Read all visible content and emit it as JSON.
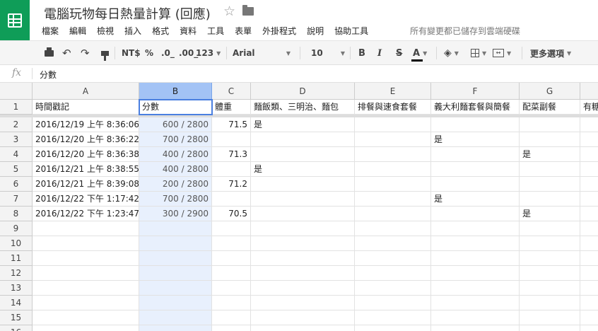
{
  "doc": {
    "title": "電腦玩物每日熱量計算 (回應)",
    "save_status": "所有變更都已儲存到雲端硬碟"
  },
  "menu": [
    "檔案",
    "編輯",
    "檢視",
    "插入",
    "格式",
    "資料",
    "工具",
    "表單",
    "外掛程式",
    "說明",
    "協助工具"
  ],
  "toolbar": {
    "currency": "NT$",
    "percent": "%",
    "dec_decrease": ".0_",
    "dec_increase": ".00_",
    "number_format": "123",
    "font": "Arial",
    "font_size": "10",
    "bold": "B",
    "italic": "I",
    "strike": "S",
    "text_color": "A",
    "more": "更多選項"
  },
  "formula": {
    "fx": "fx",
    "content": "分數"
  },
  "columns": [
    "A",
    "B",
    "C",
    "D",
    "E",
    "F",
    "G"
  ],
  "selected_column": "B",
  "header_row": [
    "時間戳記",
    "分數",
    "體重",
    "麵飯類、三明治、麵包",
    "排餐與速食套餐",
    "義大利麵套餐與簡餐",
    "配菜副餐",
    "有糖"
  ],
  "rows": [
    [
      "2016/12/19 上午 8:36:06",
      "600 / 2800",
      "71.5",
      "是",
      "",
      "",
      ""
    ],
    [
      "2016/12/20 上午 8:36:22",
      "700 / 2800",
      "",
      "",
      "",
      "是",
      ""
    ],
    [
      "2016/12/20 上午 8:36:38",
      "400 / 2800",
      "71.3",
      "",
      "",
      "",
      "是"
    ],
    [
      "2016/12/21 上午 8:38:55",
      "400 / 2800",
      "",
      "是",
      "",
      "",
      ""
    ],
    [
      "2016/12/21 上午 8:39:08",
      "200 / 2800",
      "71.2",
      "",
      "",
      "",
      ""
    ],
    [
      "2016/12/22 下午 1:17:42",
      "700 / 2800",
      "",
      "",
      "",
      "是",
      ""
    ],
    [
      "2016/12/22 下午 1:23:47",
      "300 / 2900",
      "70.5",
      "",
      "",
      "",
      "是"
    ]
  ],
  "row_numbers": [
    "1",
    "2",
    "3",
    "4",
    "5",
    "6",
    "7",
    "8",
    "9",
    "10",
    "11",
    "12",
    "13",
    "14",
    "15",
    "16"
  ]
}
